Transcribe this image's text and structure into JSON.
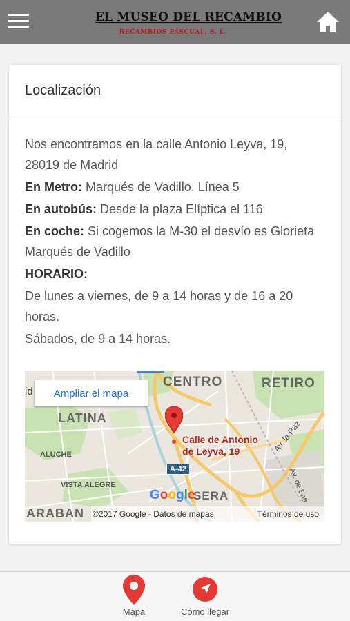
{
  "header": {
    "logo_title": "EL MUSEO DEL RECAMBIO",
    "logo_subtitle": "RECAMBIOS PASCUAL, S. L.",
    "menu_icon": "hamburger-icon",
    "home_icon": "home-icon"
  },
  "card": {
    "title": "Localización",
    "address": "Nos encontramos en la calle Antonio Leyva, 19, 28019 de Madrid",
    "metro_label": "En Metro:",
    "metro_value": " Marqués de Vadillo. Línea 5",
    "bus_label": "En autobús:",
    "bus_value": " Desde la plaza Elíptica el 116",
    "car_label": "En coche:",
    "car_value": " Si cogemos la M-30 el desvío es Glorieta Marqués de Vadillo",
    "schedule_label": "HORARIO:",
    "weekday_hours": "De lunes a viernes, de 9 a 14 horas y de 16 a 20 horas.",
    "saturday_hours": "Sábados, de 9 a 14 horas."
  },
  "map": {
    "expand_label": "Ampliar el mapa",
    "fragment_text": "id",
    "districts": {
      "centro": "CENTRO",
      "retiro": "RETIRO",
      "latina": "LATINA",
      "arganzuela_fragment": "ARABAN",
      "usera_fragment": "SERA"
    },
    "neighborhoods": {
      "aluche": "ALUCHE",
      "vista_alegre": "VISTA ALEGRE"
    },
    "roads": {
      "a42": "A-42",
      "av_paz": "Av. la Paz",
      "av_entrevias": "Av. de Entr"
    },
    "place_line1": "Calle de Antonio",
    "place_line2": "de Leyva, 19",
    "google_logo": "Google",
    "copyright": "©2017 Google - Datos de mapas",
    "terms": "Términos de uso",
    "accent": "#1a73e8",
    "pin_color": "#e53935"
  },
  "bottom_nav": {
    "map_label": "Mapa",
    "map_icon": "map-pin-icon",
    "route_label": "Cómo llegar",
    "route_icon": "navigation-arrow-icon",
    "icon_color": "#e53935"
  }
}
